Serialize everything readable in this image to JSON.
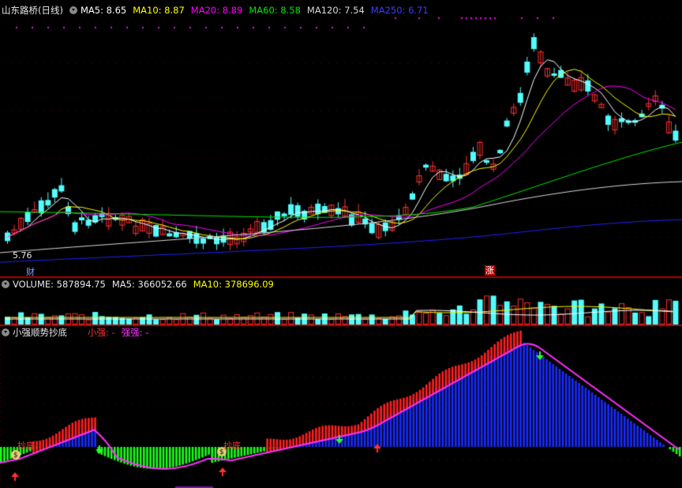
{
  "colors": {
    "bg": "#000000",
    "up": "#ff3232",
    "down": "#54fcfc",
    "ma5": "#ffffff",
    "ma10": "#ffff00",
    "ma20": "#ff00ff",
    "ma60": "#00e600",
    "ma120": "#d8d8d8",
    "ma250": "#2020ff",
    "sep": "#b00000",
    "grid": "#8b0000",
    "ind_red": "#ff2020",
    "ind_blue": "#1a2bff",
    "ind_green": "#1bff1b",
    "ind_line": "#ff30ff",
    "dots": "#ff00ff"
  },
  "price_panel": {
    "stock_title": "山东路桥(日线)",
    "menu_icon": "chevron-down-icon",
    "ma5": "MA5: 8.65",
    "ma10": "MA10: 8.87",
    "ma20": "MA20: 8.89",
    "ma60": "MA60: 8.58",
    "ma120": "MA120: 7.54",
    "ma250": "MA250: 6.71",
    "low_label": "5.76",
    "marker_cai": "财",
    "marker_zhang": "涨"
  },
  "volume_panel": {
    "volume": "VOLUME: 587894.75",
    "ma5": "MA5: 366052.66",
    "ma10": "MA10: 378696.09"
  },
  "indicator_panel": {
    "name": "小强顺势抄底",
    "xiaoqiang": "小强: -",
    "qiangqiang": "强强: -",
    "signal_label": "抄底"
  }
}
